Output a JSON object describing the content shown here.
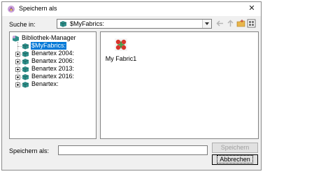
{
  "window": {
    "title": "Speichern als"
  },
  "toolbar": {
    "look_in_label": "Suche in:",
    "look_in_value": "$MyFabrics:"
  },
  "tree": {
    "items": [
      {
        "label": "Bibliothek-Manager",
        "icon": "library-icon"
      },
      {
        "label": "$MyFabrics:",
        "icon": "fabric-folder-icon",
        "selected": true
      },
      {
        "label": "Benartex 2004:",
        "icon": "fabric-folder-icon"
      },
      {
        "label": "Benartex 2006:",
        "icon": "fabric-folder-icon"
      },
      {
        "label": "Benartex 2013:",
        "icon": "fabric-folder-icon"
      },
      {
        "label": "Benartex 2016:",
        "icon": "fabric-folder-icon"
      },
      {
        "label": "Benartex:",
        "icon": "fabric-folder-icon"
      }
    ]
  },
  "files": {
    "items": [
      {
        "label": "My Fabric1",
        "icon": "fabric-file-icon"
      }
    ]
  },
  "footer": {
    "save_as_label": "Speichern als:",
    "save_as_value": "",
    "save_button": "Speichern",
    "cancel_button": "Abbrechen"
  }
}
